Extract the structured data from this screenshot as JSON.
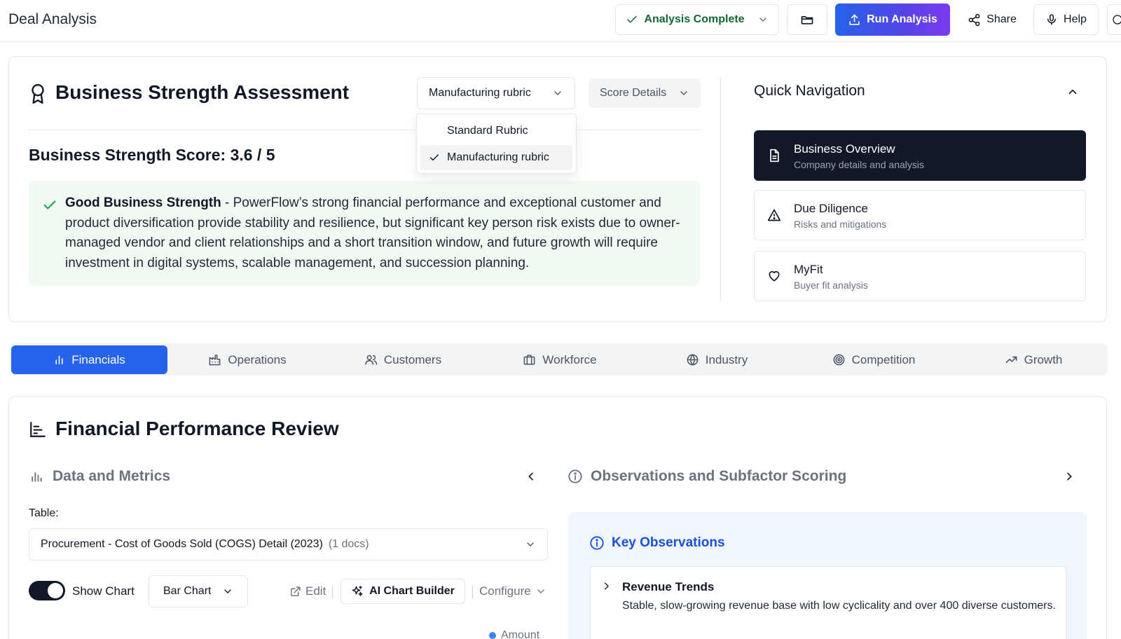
{
  "app": {
    "title": "Deal Analysis"
  },
  "toolbar": {
    "status_label": "Analysis Complete",
    "run_label": "Run Analysis",
    "share_label": "Share",
    "help_label": "Help",
    "colors": {
      "status": "#166534",
      "run_gradient_start": "#2563eb",
      "run_gradient_end": "#7c3aed"
    }
  },
  "assessment": {
    "title": "Business Strength Assessment",
    "rubric_selected": "Manufacturing rubric",
    "rubric_options": [
      "Standard Rubric",
      "Manufacturing rubric"
    ],
    "score_details_label": "Score Details",
    "score_label": "Business Strength Score: 3.6 / 5",
    "summary_heading": "Good Business Strength",
    "summary_text": " - PowerFlow’s strong financial performance and exceptional customer and product diversification provide stability and resilience, but significant key person risk exists due to owner-managed vendor and client relationships and a short transition window, and future growth will require investment in digital systems, scalable management, and succession planning."
  },
  "quick_nav": {
    "title": "Quick Navigation",
    "items": [
      {
        "label": "Business Overview",
        "sub": "Company details and analysis",
        "icon": "document-icon",
        "active": true
      },
      {
        "label": "Due Diligence",
        "sub": "Risks and mitigations",
        "icon": "warning-icon",
        "active": false
      },
      {
        "label": "MyFit",
        "sub": "Buyer fit analysis",
        "icon": "heart-icon",
        "active": false
      }
    ]
  },
  "tabs": [
    {
      "label": "Financials",
      "icon": "bar-chart-icon",
      "active": true
    },
    {
      "label": "Operations",
      "icon": "factory-icon",
      "active": false
    },
    {
      "label": "Customers",
      "icon": "users-icon",
      "active": false
    },
    {
      "label": "Workforce",
      "icon": "briefcase-icon",
      "active": false
    },
    {
      "label": "Industry",
      "icon": "globe-icon",
      "active": false
    },
    {
      "label": "Competition",
      "icon": "target-icon",
      "active": false
    },
    {
      "label": "Growth",
      "icon": "trending-up-icon",
      "active": false
    }
  ],
  "financial": {
    "title": "Financial Performance Review",
    "data_metrics_title": "Data and Metrics",
    "observations_title": "Observations and Subfactor Scoring",
    "table_label": "Table:",
    "table_selected": "Procurement - Cost of Goods Sold (COGS) Detail (2023)",
    "table_docs": "(1 docs)",
    "show_chart_label": "Show Chart",
    "show_chart_on": true,
    "chart_type_label": "Bar Chart",
    "edit_label": "Edit",
    "ai_builder_label": "AI Chart Builder",
    "configure_label": "Configure",
    "legend_label": "Amount",
    "key_observations_title": "Key Observations",
    "observations": [
      {
        "title": "Revenue Trends",
        "text": "Stable, slow-growing revenue base with low cyclicality and over 400 diverse customers."
      }
    ]
  }
}
